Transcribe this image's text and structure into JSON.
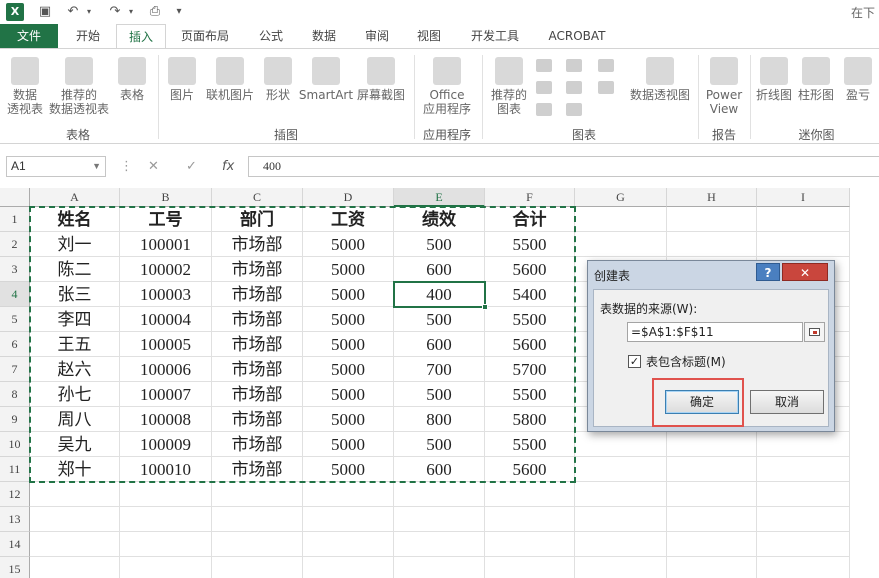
{
  "window": {
    "title_right": "在下"
  },
  "tabs": [
    "文件",
    "开始",
    "插入",
    "页面布局",
    "公式",
    "数据",
    "审阅",
    "视图",
    "开发工具",
    "ACROBAT"
  ],
  "active_tab": "插入",
  "ribbon": {
    "buttons": {
      "pivot": "数据\n透视表",
      "recommended_pivot": "推荐的\n数据透视表",
      "table": "表格",
      "picture": "图片",
      "online_picture": "联机图片",
      "shapes": "形状",
      "smartart": "SmartArt",
      "screenshot": "屏幕截图",
      "office_apps": "Office\n应用程序",
      "recommended_charts": "推荐的\n图表",
      "pivot_chart": "数据透视图",
      "power_view": "Power\nView",
      "line_spark": "折线图",
      "column_spark": "柱形图",
      "winloss_spark": "盈亏"
    },
    "groups": {
      "tables": "表格",
      "illustrations": "插图",
      "apps": "应用程序",
      "charts": "图表",
      "reports": "报告",
      "sparklines": "迷你图"
    }
  },
  "formula_bar": {
    "name_box": "A1",
    "cancel_icon": "✕",
    "enter_icon": "✓",
    "fx_icon": "fx",
    "value": "400"
  },
  "sheet": {
    "columns": [
      "A",
      "B",
      "C",
      "D",
      "E",
      "F",
      "G",
      "H",
      "I"
    ],
    "rows": [
      "1",
      "2",
      "3",
      "4",
      "5",
      "6",
      "7",
      "8",
      "9",
      "10",
      "11",
      "12",
      "13",
      "14",
      "15"
    ],
    "header": [
      "姓名",
      "工号",
      "部门",
      "工资",
      "绩效",
      "合计"
    ],
    "data": [
      [
        "刘一",
        "100001",
        "市场部",
        "5000",
        "500",
        "5500"
      ],
      [
        "陈二",
        "100002",
        "市场部",
        "5000",
        "600",
        "5600"
      ],
      [
        "张三",
        "100003",
        "市场部",
        "5000",
        "400",
        "5400"
      ],
      [
        "李四",
        "100004",
        "市场部",
        "5000",
        "500",
        "5500"
      ],
      [
        "王五",
        "100005",
        "市场部",
        "5000",
        "600",
        "5600"
      ],
      [
        "赵六",
        "100006",
        "市场部",
        "5000",
        "700",
        "5700"
      ],
      [
        "孙七",
        "100007",
        "市场部",
        "5000",
        "500",
        "5500"
      ],
      [
        "周八",
        "100008",
        "市场部",
        "5000",
        "800",
        "5800"
      ],
      [
        "吴九",
        "100009",
        "市场部",
        "5000",
        "500",
        "5500"
      ],
      [
        "郑十",
        "100010",
        "市场部",
        "5000",
        "600",
        "5600"
      ]
    ]
  },
  "dialog": {
    "title": "创建表",
    "help": "?",
    "close": "✕",
    "source_label": "表数据的来源(W):",
    "range_value": "=$A$1:$F$11",
    "has_headers_checked": true,
    "has_headers_label": "表包含标题(M)",
    "ok_label": "确定",
    "cancel_label": "取消"
  },
  "colors": {
    "excel_green": "#217346",
    "highlight_red": "#e0524d"
  }
}
